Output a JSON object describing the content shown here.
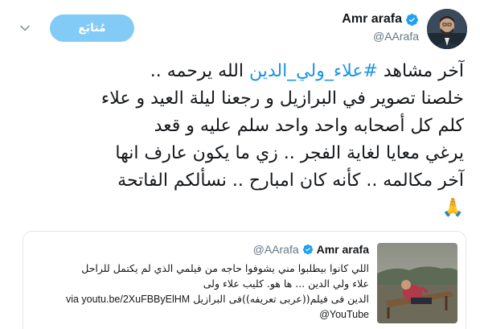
{
  "author": {
    "display_name": "Amr arafa",
    "handle": "@AArafa",
    "avatar_icon": "profile-photo"
  },
  "follow_button": {
    "label": "مُتابَع"
  },
  "tweet": {
    "line1_before": "آخر مشاهد ",
    "hashtag": "#علاء_ولي_الدين",
    "line1_after": " الله يرحمه ..",
    "line2": "خلصنا تصوير في البرازيل و رجعنا ليلة العيد و علاء",
    "line3": "كلم كل أصحابه واحد واحد  سلم عليه و قعد",
    "line4": "يرغي معايا لغاية الفجر .. زي ما يكون عارف انها",
    "line5": "آخر مكالمه .. كأنه كان امبارح .. نسألكم الفاتحة",
    "emoji": "🙏"
  },
  "quote": {
    "display_name": "Amr arafa",
    "handle": "@AArafa",
    "line1": "اللي كانوا بيطلبوا مني يشوفوا حاجه من فيلمي الذي لم يكتمل للراحل",
    "line2": "علاء ولي الدين ... ها هو.                       كليب علاء ولى",
    "line3_ar": "الدين فى فيلم((عربى تعريفه))فى البرازيل",
    "line3_link": "via youtu.be/2XuFBByElHM",
    "line4": "@YouTube"
  },
  "colors": {
    "accent": "#1da1f2",
    "link": "#1b95e0",
    "text": "#14171a",
    "muted": "#657786",
    "border": "#e1e8ed"
  }
}
